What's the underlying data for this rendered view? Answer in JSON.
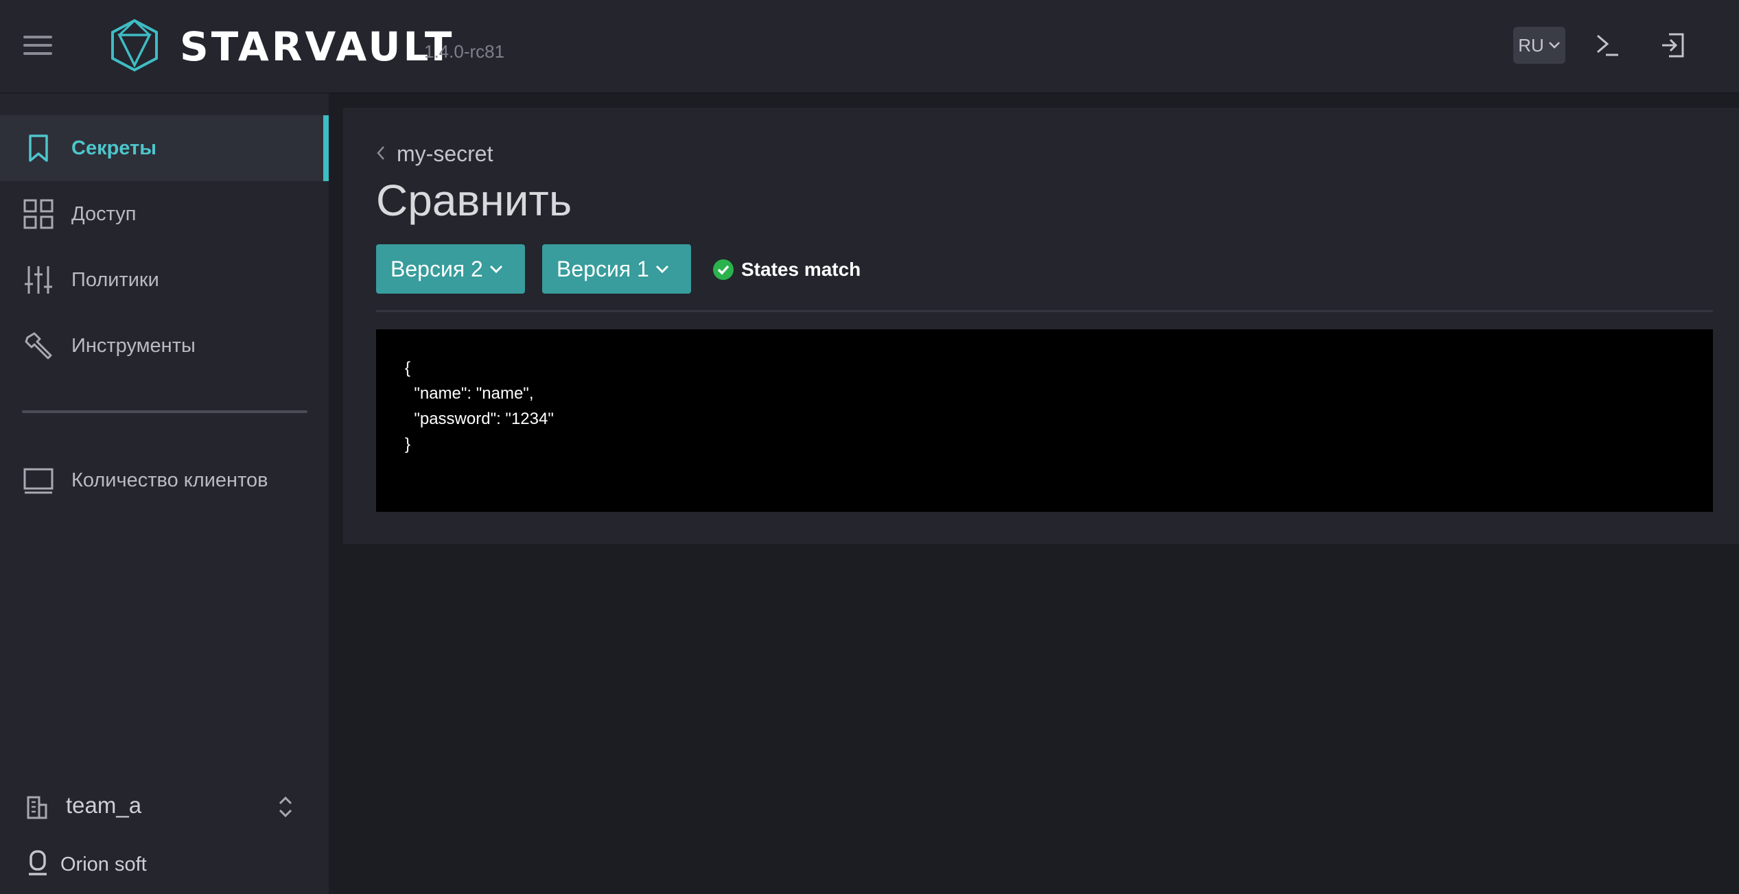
{
  "header": {
    "brand": "STARVAULT",
    "version": "1.4.0-rc81",
    "lang": "RU",
    "accent_color": "#3fbdc4"
  },
  "sidebar": {
    "items": [
      {
        "label": "Секреты",
        "icon": "bookmark-icon",
        "active": true
      },
      {
        "label": "Доступ",
        "icon": "grid-icon",
        "active": false
      },
      {
        "label": "Политики",
        "icon": "sliders-icon",
        "active": false
      },
      {
        "label": "Инструменты",
        "icon": "wrench-icon",
        "active": false
      }
    ],
    "clients": {
      "label": "Количество клиентов",
      "icon": "monitor-icon"
    },
    "team": "team_a",
    "org": "Orion soft"
  },
  "main": {
    "breadcrumb": "my-secret",
    "title": "Сравнить",
    "left_version": "Версия 2",
    "right_version": "Версия 1",
    "status": "States match",
    "status_color": "#2bb24c",
    "button_color": "#389d9c",
    "code": "{\n  \"name\": \"name\",\n  \"password\": \"1234\"\n}"
  }
}
